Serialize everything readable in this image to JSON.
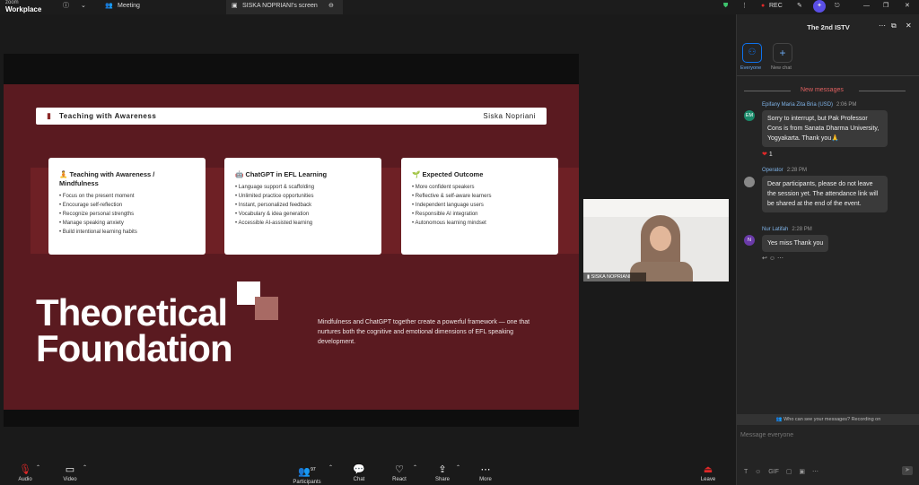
{
  "app": {
    "logo_line1": "zoom",
    "logo_line2": "Workplace"
  },
  "titlebar": {
    "meeting_label": "Meeting",
    "share_tab_label": "SISKA NOPRIANI's screen",
    "rec_label": "REC"
  },
  "slide": {
    "header_title": "Teaching with Awareness",
    "header_presenter": "Siska Nopriani",
    "cards": [
      {
        "title": "Teaching with Awareness / Mindfulness",
        "items": [
          "Focus on the present moment",
          "Encourage self-reflection",
          "Recognize personal strengths",
          "Manage speaking anxiety",
          "Build intentional learning habits"
        ]
      },
      {
        "title": "ChatGPT in EFL Learning",
        "items": [
          "Language support & scaffolding",
          "Unlimited practice opportunities",
          "Instant, personalized feedback",
          "Vocabulary & idea generation",
          "Accessible AI-assisted learning"
        ]
      },
      {
        "title": "Expected Outcome",
        "items": [
          "More confident speakers",
          "Reflective & self-aware learners",
          "Independent language users",
          "Responsible AI integration",
          "Autonomous learning mindset"
        ]
      }
    ],
    "big_title_line1": "Theoretical",
    "big_title_line2": "Foundation",
    "paragraph": "Mindfulness and ChatGPT together create a powerful framework — one that nurtures both the cognitive and emotional dimensions of EFL speaking development."
  },
  "camera": {
    "name_label": "SISKA NOPRIANI"
  },
  "toolbar": {
    "audio": "Audio",
    "video": "Video",
    "participants": "Participants",
    "participants_count": "97",
    "chat": "Chat",
    "react": "React",
    "share": "Share",
    "more": "More",
    "leave": "Leave"
  },
  "chat": {
    "title": "The 2nd ISTV",
    "everyone_label": "Everyone",
    "new_chat_label": "New chat",
    "new_messages_label": "New messages",
    "messages": [
      {
        "initials": "EM",
        "name": "Epifany Maria Zita Bria (USD)",
        "time": "2:06 PM",
        "text": "Sorry to interrupt, but Pak Professor Cons is from Sanata Dharma University, Yogyakarta. Thank you🙏",
        "reaction_count": "1"
      },
      {
        "initials": "",
        "name": "Operator",
        "time": "2:28 PM",
        "text": "Dear participants, please do not leave the session yet. The attendance link will be shared at the end of the event."
      },
      {
        "initials": "N",
        "name": "Nur Latifah",
        "time": "2:28 PM",
        "text": "Yes miss Thank you"
      }
    ],
    "visibility_note": "Who can see your messages? Recording on",
    "input_placeholder": "Message everyone"
  },
  "colors": {
    "slide_bg": "#5a1a20",
    "accent": "#0e72ed",
    "rec": "#e02828"
  }
}
